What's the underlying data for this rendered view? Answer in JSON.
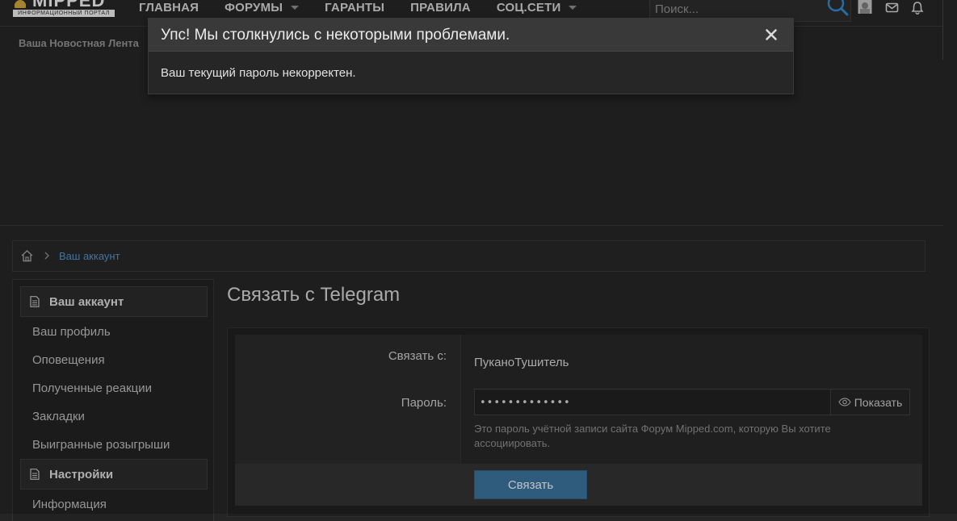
{
  "header": {
    "logo_text": "MIPPED",
    "logo_subtitle": "ИНФОРМАЦИОННЫЙ ПОРТАЛ",
    "nav": [
      {
        "label": "ГЛАВНАЯ",
        "has_dropdown": false
      },
      {
        "label": "ФОРУМЫ",
        "has_dropdown": true
      },
      {
        "label": "ГАРАНТЫ",
        "has_dropdown": false
      },
      {
        "label": "ПРАВИЛА",
        "has_dropdown": false
      },
      {
        "label": "СОЦ.СЕТИ",
        "has_dropdown": true
      }
    ],
    "search_placeholder": "Поиск...",
    "icons": [
      "search-icon",
      "avatar-icon",
      "envelope-icon",
      "bell-icon"
    ],
    "accent_color": "#2f86c8"
  },
  "feed_tab": "Ваша Новостная Лента",
  "breadcrumb": {
    "icons": [
      "home-icon",
      "chevron-right-icon"
    ],
    "link": "Ваш аккаунт"
  },
  "sidebar": {
    "account_head": "Ваш аккаунт",
    "account_links": [
      "Ваш профиль",
      "Оповещения",
      "Полученные реакции",
      "Закладки",
      "Выигранные розыгрыши"
    ],
    "settings_head": "Настройки",
    "settings_links": [
      "Информация"
    ]
  },
  "main": {
    "title": "Связать с Telegram",
    "link_with_label": "Связать с:",
    "link_with_value": "ПуканоТушитель",
    "password_label": "Пароль:",
    "password_value": "•••••••••••••",
    "show_label": "Показать",
    "hint": "Это пароль учётной записи сайта Форум Mipped.com, которую Вы хотите ассоциировать.",
    "submit_label": "Связать",
    "button_color": "#3a6f98"
  },
  "modal": {
    "title": "Упс! Мы столкнулись с некоторыми проблемами.",
    "message": "Ваш текущий пароль некорректен."
  }
}
